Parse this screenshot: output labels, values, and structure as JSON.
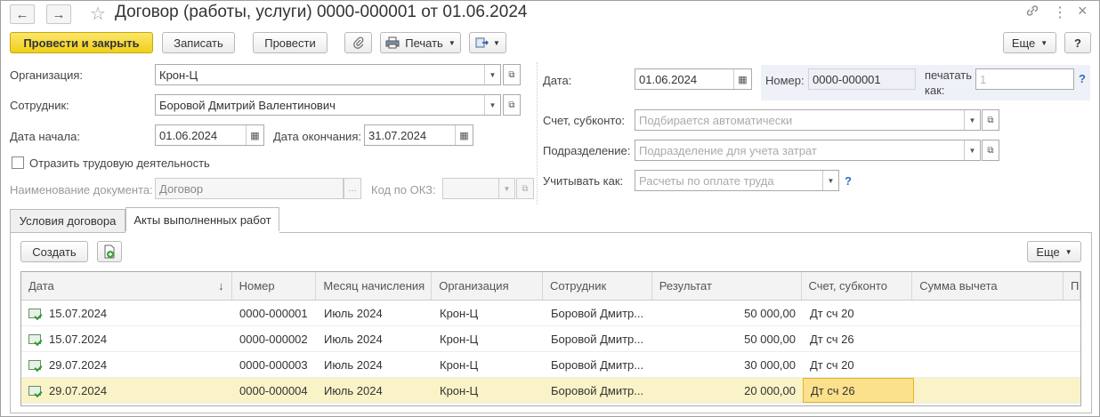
{
  "window": {
    "title": "Договор (работы, услуги) 0000-000001 от 01.06.2024",
    "back_icon": "←",
    "forward_icon": "→",
    "star_icon": "☆",
    "link_icon": "🔗",
    "menu_icon": "⋮",
    "close_icon": "×"
  },
  "toolbar": {
    "post_close": "Провести и закрыть",
    "save": "Записать",
    "post": "Провести",
    "attach_icon": "📎",
    "print": "Печать",
    "more": "Еще",
    "help": "?"
  },
  "form": {
    "org_label": "Организация:",
    "org_value": "Крон-Ц",
    "employee_label": "Сотрудник:",
    "employee_value": "Боровой Дмитрий Валентинович",
    "start_label": "Дата начала:",
    "start_value": "01.06.2024",
    "end_label": "Дата окончания:",
    "end_value": "31.07.2024",
    "labor_label": "Отразить трудовую деятельность",
    "docname_label": "Наименование документа:",
    "docname_value": "Договор",
    "okz_label": "Код по ОКЗ:",
    "date_label": "Дата:",
    "date_value": "01.06.2024",
    "number_label": "Номер:",
    "number_value": "0000-000001",
    "print_as_label_1": "печатать",
    "print_as_label_2": "как:",
    "print_as_value": "1",
    "account_label": "Счет, субконто:",
    "account_placeholder": "Подбирается автоматически",
    "dept_label": "Подразделение:",
    "dept_placeholder": "Подразделение для учета затрат",
    "account_as_label": "Учитывать как:",
    "account_as_placeholder": "Расчеты по оплате труда",
    "help_q": "?"
  },
  "tabs": [
    {
      "label": "Условия договора"
    },
    {
      "label": "Акты выполненных работ"
    }
  ],
  "acts": {
    "create": "Создать",
    "more": "Еще",
    "columns": [
      "Дата",
      "Номер",
      "Месяц начисления",
      "Организация",
      "Сотрудник",
      "Результат",
      "Счет, субконто",
      "Сумма вычета",
      "По"
    ],
    "sort_icon": "↓",
    "rows": [
      {
        "date": "15.07.2024",
        "number": "0000-000001",
        "month": "Июль 2024",
        "org": "Крон-Ц",
        "employee": "Боровой Дмитр...",
        "result": "50 000,00",
        "account": "Дт сч 20"
      },
      {
        "date": "15.07.2024",
        "number": "0000-000002",
        "month": "Июль 2024",
        "org": "Крон-Ц",
        "employee": "Боровой Дмитр...",
        "result": "50 000,00",
        "account": "Дт сч 26"
      },
      {
        "date": "29.07.2024",
        "number": "0000-000003",
        "month": "Июль 2024",
        "org": "Крон-Ц",
        "employee": "Боровой Дмитр...",
        "result": "30 000,00",
        "account": "Дт сч 20"
      },
      {
        "date": "29.07.2024",
        "number": "0000-000004",
        "month": "Июль 2024",
        "org": "Крон-Ц",
        "employee": "Боровой Дмитр...",
        "result": "20 000,00",
        "account": "Дт сч 26"
      }
    ]
  }
}
